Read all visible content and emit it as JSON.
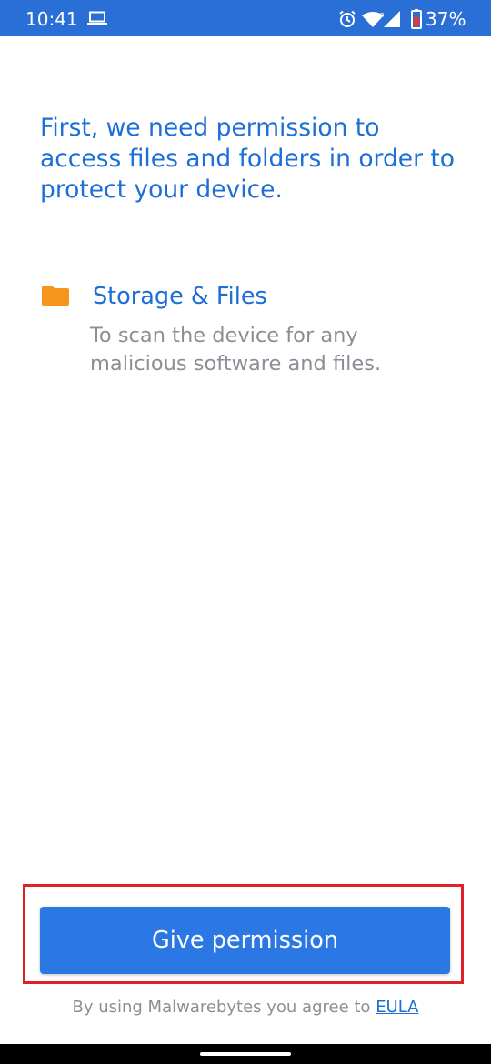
{
  "status_bar": {
    "time": "10:41",
    "battery_percent": "37%",
    "icons": [
      "laptop-icon",
      "alarm-icon",
      "wifi-icon",
      "signal-icon",
      "battery-icon"
    ],
    "colors": {
      "background": "#2a6fd6",
      "battery_low": "#e53935"
    }
  },
  "main": {
    "heading": "First, we need permission to access files and folders in order to protect your device.",
    "permission": {
      "icon": "folder-icon",
      "title": "Storage & Files",
      "description": "To scan the device for any malicious software and files."
    }
  },
  "footer": {
    "button_label": "Give permission",
    "agreement_text": "By using Malwarebytes you agree to",
    "eula_link": "EULA"
  },
  "colors": {
    "accent": "#1c6fd6",
    "button": "#2b78e4",
    "folder": "#f7941d",
    "muted_text": "#8a8f96",
    "highlight": "#e0202a"
  }
}
